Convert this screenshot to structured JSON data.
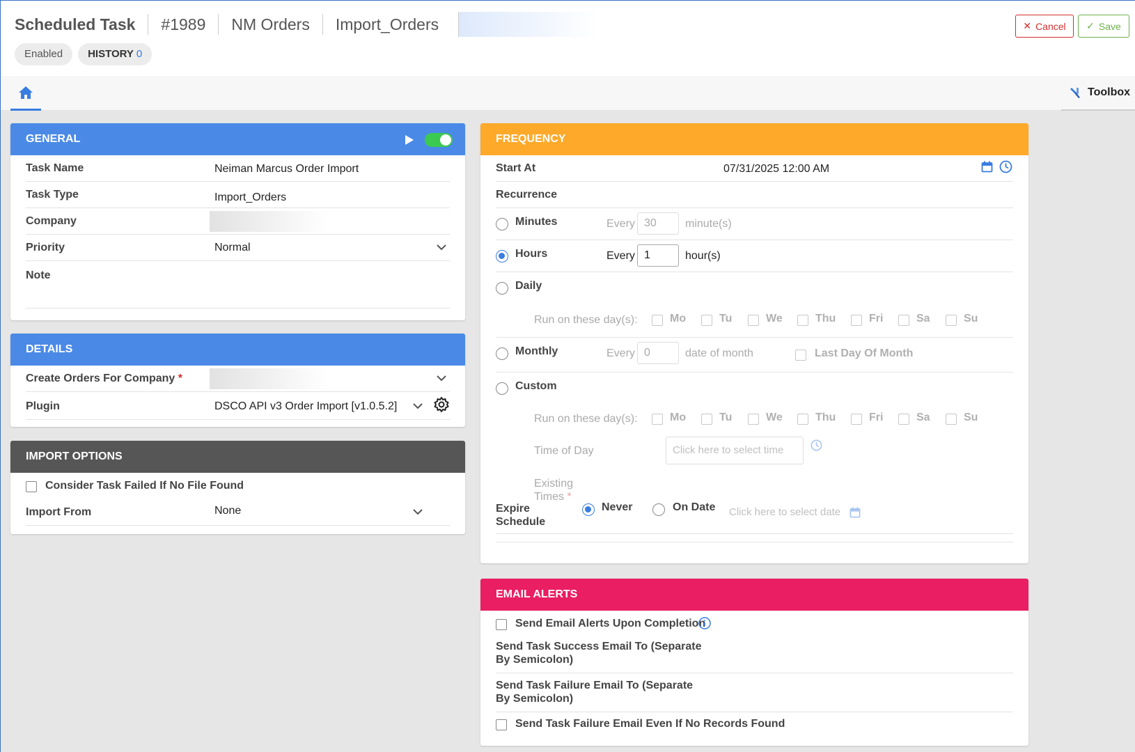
{
  "header": {
    "title": "Scheduled Task",
    "breadcrumbs": [
      "#1989",
      "NM Orders",
      "Import_Orders"
    ],
    "status_chip": "Enabled",
    "history_label": "HISTORY",
    "history_count": "0",
    "cancel_label": "Cancel",
    "save_label": "Save"
  },
  "tabbar": {
    "home_icon": "home-icon",
    "toolbox_label": "Toolbox"
  },
  "general": {
    "title": "GENERAL",
    "enabled_toggle": true,
    "task_name_label": "Task Name",
    "task_name": "Neiman Marcus Order Import",
    "task_type_label": "Task Type",
    "task_type": "Import_Orders",
    "company_label": "Company",
    "priority_label": "Priority",
    "priority": "Normal",
    "note_label": "Note"
  },
  "details": {
    "title": "DETAILS",
    "create_orders_label": "Create Orders For Company",
    "required_mark": "*",
    "plugin_label": "Plugin",
    "plugin": "DSCO API v3 Order Import [v1.0.5.2]"
  },
  "import_options": {
    "title": "IMPORT OPTIONS",
    "consider_failed_label": "Consider Task Failed If No File Found",
    "import_from_label": "Import From",
    "import_from": "None"
  },
  "frequency": {
    "title": "FREQUENCY",
    "start_at_label": "Start At",
    "start_at": "07/31/2025 12:00 AM",
    "recurrence_label": "Recurrence",
    "minutes_label": "Minutes",
    "every": "Every",
    "minutes_value": "30",
    "minutes_unit": "minute(s)",
    "hours_label": "Hours",
    "hours_value": "1",
    "hours_unit": "hour(s)",
    "daily_label": "Daily",
    "run_days_label": "Run on these day(s):",
    "days": [
      "Mo",
      "Tu",
      "We",
      "Thu",
      "Fri",
      "Sa",
      "Su"
    ],
    "monthly_label": "Monthly",
    "monthly_value": "0",
    "monthly_unit": "date of month",
    "last_day_label": "Last Day Of Month",
    "custom_label": "Custom",
    "time_of_day_label": "Time of Day",
    "time_placeholder": "Click here to select time",
    "existing_times_label": "Existing Times",
    "expire_label": "Expire Schedule",
    "never_label": "Never",
    "on_date_label": "On Date",
    "date_placeholder": "Click here to select date",
    "selected_recurrence": "Hours",
    "selected_expire": "Never"
  },
  "email_alerts": {
    "title": "EMAIL ALERTS",
    "send_on_completion": "Send Email Alerts Upon Completion",
    "success_email_label": "Send Task Success Email To (Separate By Semicolon)",
    "failure_email_label": "Send Task Failure Email To (Separate By Semicolon)",
    "failure_even_if_none": "Send Task Failure Email Even If No Records Found"
  },
  "colors": {
    "general_header": "#4a8ae6",
    "details_header": "#4a8ae6",
    "import_header": "#565656",
    "frequency_header": "#fea92a",
    "email_header": "#e91e63",
    "accent": "#3a7de0",
    "toggle_on": "#3bc94f"
  }
}
